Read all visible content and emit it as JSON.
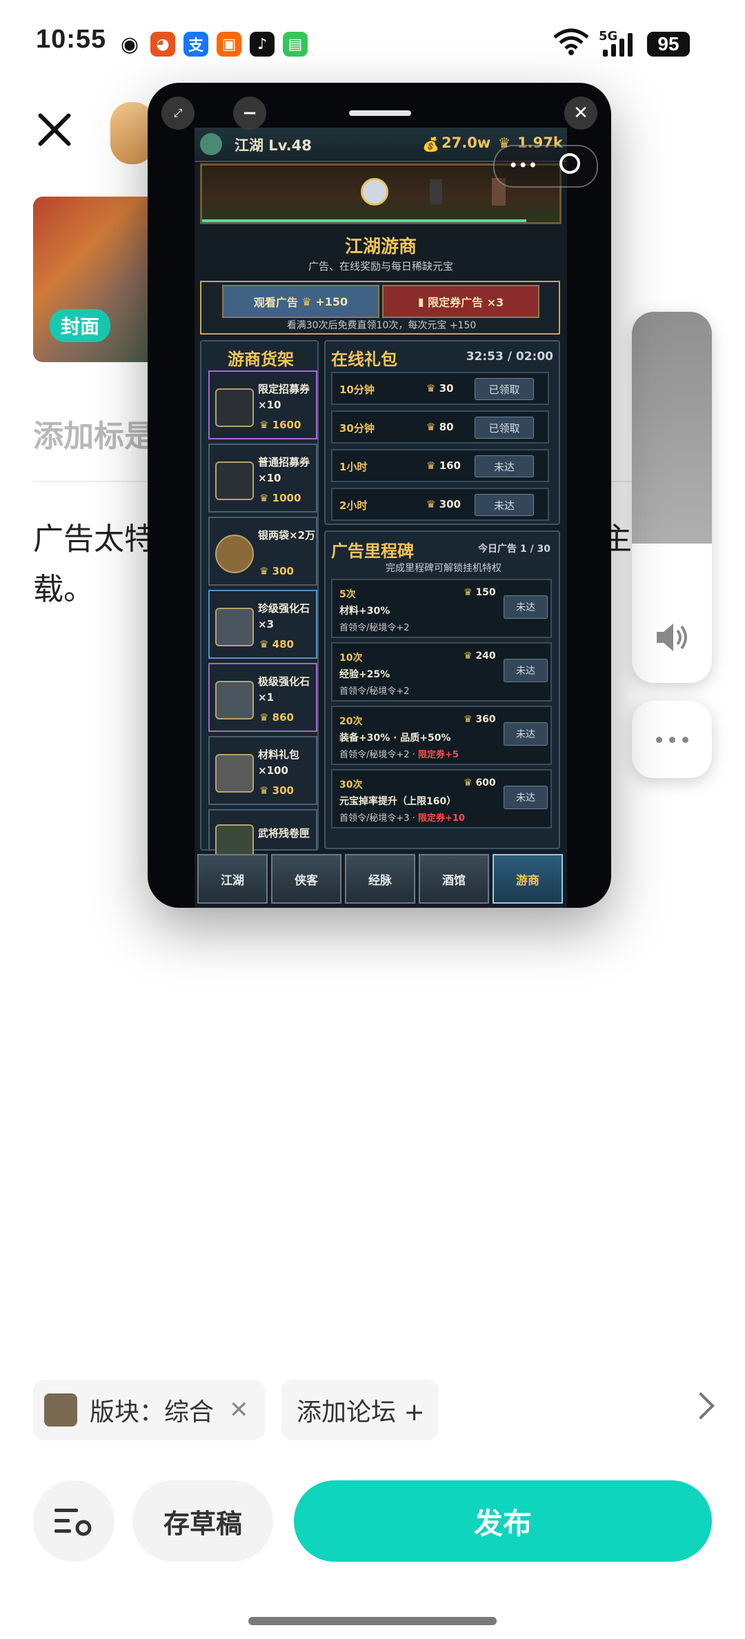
{
  "status": {
    "time": "10:55",
    "network": "5G",
    "battery": "95"
  },
  "post": {
    "cover_badge": "封面",
    "title_placeholder": "添加标是",
    "body_line1": "广告太特",
    "body_line1_right": "主了",
    "body_line2": "载。"
  },
  "game": {
    "player": "江湖 Lv.48",
    "money": "27.0w",
    "ingots": "1.97k",
    "shop_title": "江湖游商",
    "shop_sub": "广告、在线奖励与每日稀缺元宝",
    "watch_ad": "观看广告",
    "watch_ad_reward": "+150",
    "ticket_ad": "限定券广告 ×3",
    "ad_note": "看满30次后免费直领10次，每次元宝 +150",
    "shelf_title": "游商货架",
    "shelf": [
      {
        "name": "限定招募券×10",
        "price": "1600"
      },
      {
        "name": "普通招募券×10",
        "price": "1000"
      },
      {
        "name": "银两袋×2万",
        "price": "300"
      },
      {
        "name": "珍级强化石×3",
        "price": "480"
      },
      {
        "name": "极级强化石×1",
        "price": "860"
      },
      {
        "name": "材料礼包×100",
        "price": "300"
      },
      {
        "name": "武将残卷匣",
        "price": ""
      }
    ],
    "online_title": "在线礼包",
    "online_timer": "32:53 / 02:00",
    "online": [
      {
        "time": "10分钟",
        "value": "30",
        "state": "已领取"
      },
      {
        "time": "30分钟",
        "value": "80",
        "state": "已领取"
      },
      {
        "time": "1小时",
        "value": "160",
        "state": "未达"
      },
      {
        "time": "2小时",
        "value": "300",
        "state": "未达"
      }
    ],
    "milestone_title": "广告里程碑",
    "milestone_today": "今日广告 1 / 30",
    "milestone_sub": "完成里程碑可解锁挂机特权",
    "milestones": [
      {
        "count": "5次",
        "value": "150",
        "desc": "材料+30%",
        "extra": "首领令/秘境令+2",
        "extra_red": "",
        "state": "未达"
      },
      {
        "count": "10次",
        "value": "240",
        "desc": "经验+25%",
        "extra": "首领令/秘境令+2",
        "extra_red": "",
        "state": "未达"
      },
      {
        "count": "20次",
        "value": "360",
        "desc": "装备+30% · 品质+50%",
        "extra": "首领令/秘境令+2 ·",
        "extra_red": "限定券+5",
        "state": "未达"
      },
      {
        "count": "30次",
        "value": "600",
        "desc": "元宝掉率提升（上限160）",
        "extra": "首领令/秘境令+3 ·",
        "extra_red": "限定券+10",
        "state": "未达"
      }
    ],
    "tabs": [
      "江湖",
      "侠客",
      "经脉",
      "酒馆",
      "游商"
    ]
  },
  "bottom": {
    "board_chip": "版块：综合",
    "forum_chip": "添加论坛 +",
    "draft": "存草稿",
    "publish": "发布"
  },
  "colors": {
    "accent": "#0fd4be",
    "game_gold": "#f1c45a",
    "game_bg": "#141c24"
  }
}
